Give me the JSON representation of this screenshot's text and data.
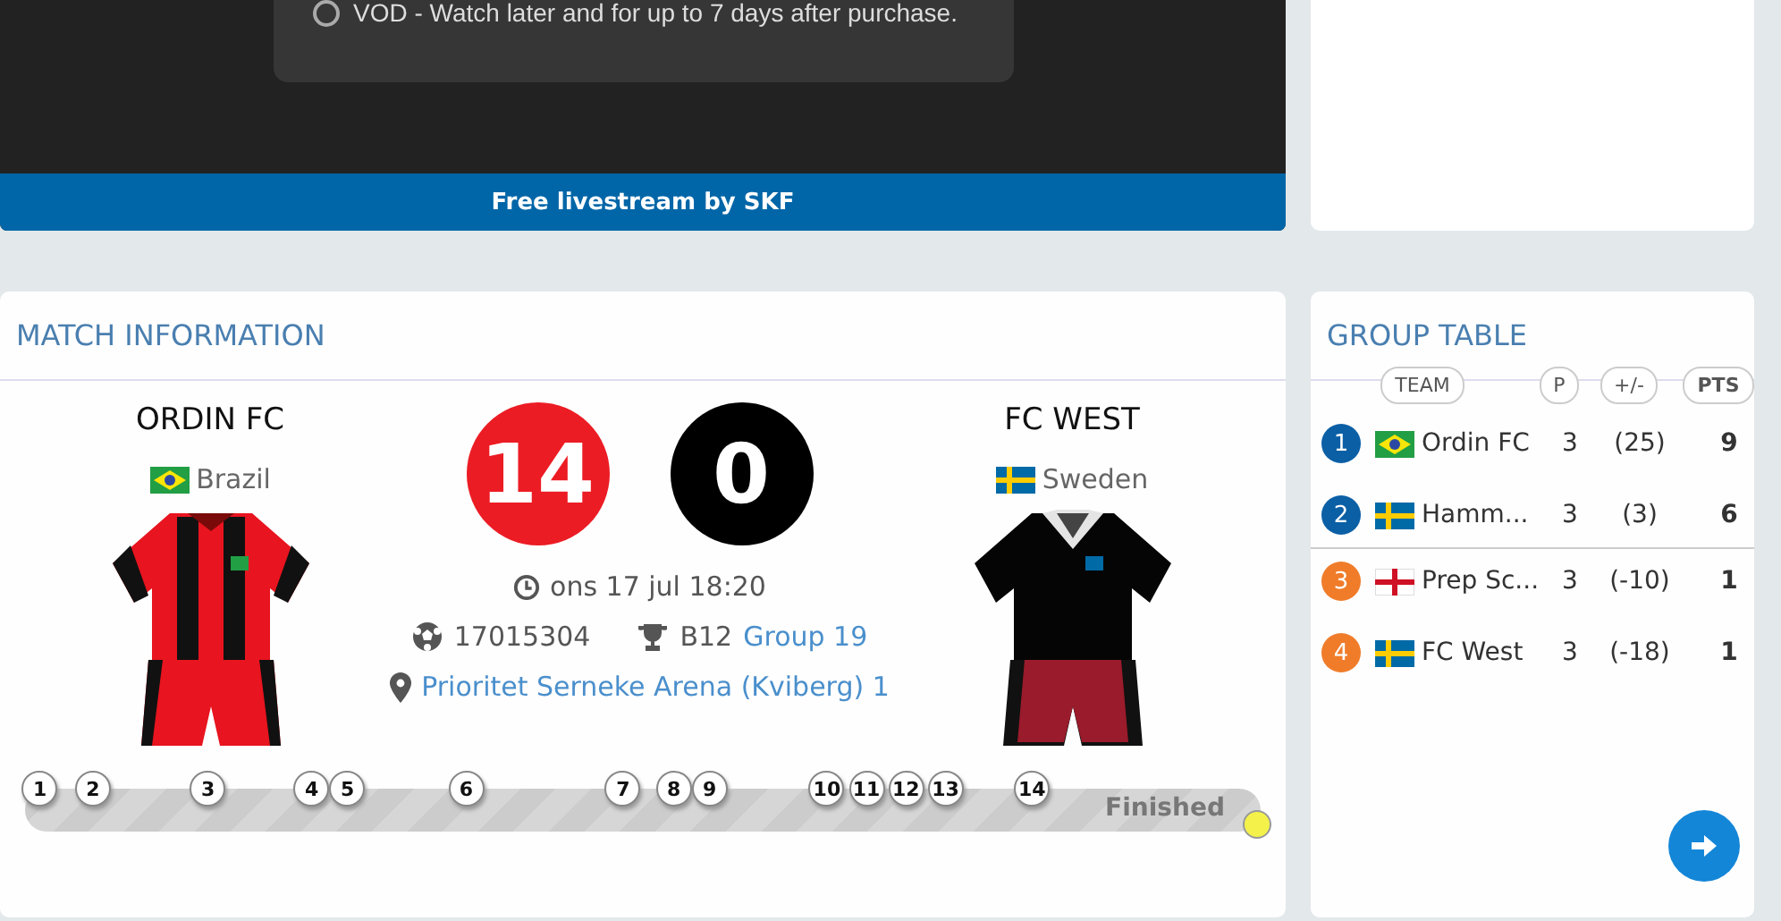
{
  "player": {
    "option": "VOD - Watch later and for up to 7 days after purchase.",
    "option_selected": false,
    "banner": "Free livestream by SKF"
  },
  "match": {
    "title": "MATCH INFORMATION",
    "teams": [
      {
        "name": "ORDIN FC",
        "country": "Brazil",
        "flag": {
          "kind": "brazil"
        },
        "kit": {
          "kind": "striped"
        },
        "score": "14",
        "color": "#ec1c24"
      },
      {
        "name": "FC WEST",
        "country": "Sweden",
        "flag": {
          "kind": "sweden"
        },
        "kit": {
          "kind": "plain"
        },
        "score": "0",
        "color": "#000000"
      }
    ],
    "time": "ons 17 jul 18:20",
    "match_id": "17015304",
    "category": "B12",
    "group": "Group 19",
    "venue": "Prioritet Serneke Arena (Kviberg) 1",
    "goals": [
      {
        "label": "1",
        "level": 0.012
      },
      {
        "label": "2",
        "level": 0.055
      },
      {
        "label": "3",
        "level": 0.148
      },
      {
        "label": "4",
        "level": 0.232
      },
      {
        "label": "5",
        "level": 0.261
      },
      {
        "label": "6",
        "level": 0.357
      },
      {
        "label": "7",
        "level": 0.484
      },
      {
        "label": "8",
        "level": 0.525
      },
      {
        "label": "9",
        "level": 0.554
      },
      {
        "label": "10",
        "level": 0.649
      },
      {
        "label": "11",
        "level": 0.681
      },
      {
        "label": "12",
        "level": 0.713
      },
      {
        "label": "13",
        "level": 0.745
      },
      {
        "label": "14",
        "level": 0.815
      }
    ],
    "status": "Finished"
  },
  "group_table": {
    "title": "GROUP TABLE",
    "columns": [
      "TEAM",
      "P",
      "+/-",
      "PTS"
    ],
    "rows": [
      {
        "rank": "1",
        "color": "#0b5fa5",
        "flag": {
          "kind": "brazil"
        },
        "team": "Ordin FC",
        "p": "3",
        "diff": "(25)",
        "pts": "9"
      },
      {
        "rank": "2",
        "color": "#0b5fa5",
        "flag": {
          "kind": "sweden"
        },
        "team": "Hamm...",
        "p": "3",
        "diff": "(3)",
        "pts": "6"
      },
      {
        "rank": "3",
        "color": "#f07c2a",
        "flag": {
          "kind": "england"
        },
        "team": "Prep Sc...",
        "p": "3",
        "diff": "(-10)",
        "pts": "1"
      },
      {
        "rank": "4",
        "color": "#f07c2a",
        "flag": {
          "kind": "sweden"
        },
        "team": "FC West",
        "p": "3",
        "diff": "(-18)",
        "pts": "1"
      }
    ]
  }
}
